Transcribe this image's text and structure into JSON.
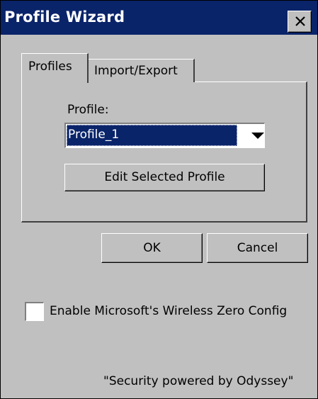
{
  "window": {
    "title": "Profile Wizard",
    "close_icon": "close-icon"
  },
  "tabs": [
    {
      "label": "Profiles",
      "selected": true
    },
    {
      "label": "Import/Export",
      "selected": false
    }
  ],
  "profile_section": {
    "label": "Profile:",
    "selected_profile": "Profile_1",
    "dropdown_icon": "chevron-down-icon",
    "edit_button_label": "Edit Selected Profile"
  },
  "actions": {
    "ok_label": "OK",
    "cancel_label": "Cancel"
  },
  "options": {
    "wzc_label": "Enable Microsoft's Wireless Zero Config",
    "wzc_checked": false
  },
  "footer": {
    "text": "\"Security powered by Odyssey\""
  },
  "colors": {
    "title_bar": "#0a246a",
    "window_face": "#c0c0c0",
    "selection": "#0a246a"
  }
}
